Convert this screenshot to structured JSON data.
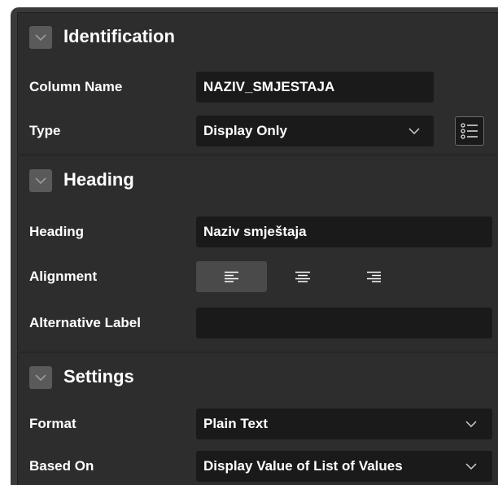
{
  "colors": {
    "panel_bg": "#3a3a3a",
    "section_bg": "#2d2d2d",
    "field_bg": "#1a1a1a",
    "text": "#ffffff",
    "collapse_button": "#5a5a5a"
  },
  "identification": {
    "title": "Identification",
    "column_name_label": "Column Name",
    "column_name_value": "NAZIV_SMJESTAJA",
    "type_label": "Type",
    "type_value": "Display Only",
    "type_icon": "chevron-down-icon",
    "list_button_icon": "list-icon"
  },
  "heading": {
    "title": "Heading",
    "heading_label": "Heading",
    "heading_value": "Naziv smještaja",
    "alignment_label": "Alignment",
    "alignment_options": [
      "align-left-icon",
      "align-center-icon",
      "align-right-icon"
    ],
    "alignment_selected": "align-left-icon",
    "alternative_label_label": "Alternative Label",
    "alternative_label_value": ""
  },
  "settings": {
    "title": "Settings",
    "format_label": "Format",
    "format_value": "Plain Text",
    "based_on_label": "Based On",
    "based_on_value": "Display Value of List of Values"
  }
}
